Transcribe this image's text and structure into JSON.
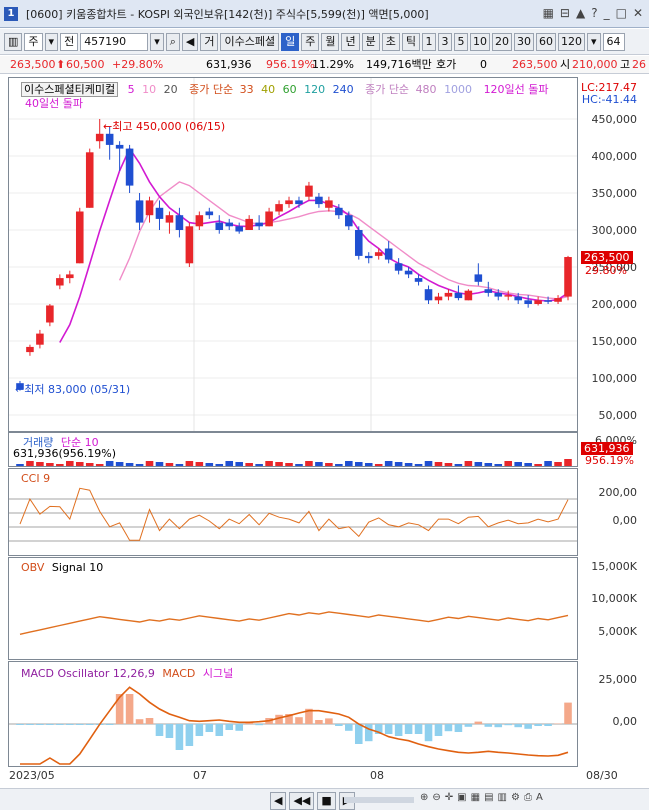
{
  "window": {
    "app_badge": "1",
    "title": "[0600] 키움종합차트 - KOSPI 외국인보유[142(천)] 주식수[5,599(천)] 액면[5,000]"
  },
  "toolbar": {
    "period_combo": "주",
    "market_btn": "전",
    "code": "457190",
    "name_prefix": "거",
    "stock_name": "이수스페셜",
    "period_buttons": [
      "일",
      "주",
      "월",
      "년",
      "분",
      "초",
      "틱"
    ],
    "active_period": "일",
    "interval_buttons": [
      "1",
      "3",
      "5",
      "10",
      "20",
      "30",
      "60",
      "120"
    ],
    "count": "64"
  },
  "info": {
    "price": "263,500",
    "change": "60,500",
    "change_pct": "+29.80%",
    "volume": "631,936",
    "volume_ratio": "956.19%",
    "turnover": "11.29%",
    "amount": "149,716백만",
    "quote_label": "호가",
    "quote_value": "0",
    "current": "263,500",
    "open_label": "시",
    "open": "210,000",
    "high_label": "고",
    "high": "26"
  },
  "price_pane": {
    "legend_name": "이수스페셜티케미컬",
    "ma_periods": [
      "5",
      "10",
      "20"
    ],
    "ma_label": "종가 단순",
    "ma_periods2": [
      "33",
      "40",
      "60",
      "120",
      "240"
    ],
    "ma_label2": "종가 단순",
    "ma_periods3": [
      "480",
      "1000"
    ],
    "breakout1": "120일선 돌파",
    "breakout2": "40일선 돌파",
    "lc": "LC:217.47",
    "hc": "HC:-41.44",
    "high_marker": "최고 450,000 (06/15)",
    "low_marker": "최저 83,000 (05/31)",
    "axis": [
      "450,000",
      "400,000",
      "350,000",
      "300,000",
      "250,000",
      "200,000",
      "150,000",
      "100,000",
      "50,000"
    ],
    "last_price_tag": "263,500",
    "last_pct_tag": "29.80%",
    "colors": {
      "up": "#e8262a",
      "down": "#1f4fd1",
      "ma5": "#d21ad2",
      "ma10": "#f08cc8",
      "ma20": "#333333",
      "ma60": "#d24d1a",
      "ma120": "#90b030"
    }
  },
  "volume_pane": {
    "title": "거래량",
    "ma_label": "단순 10",
    "value_text": "631,936(956.19%)",
    "axis_top": "6,000%",
    "tag1": "631,936",
    "tag2": "956.19%"
  },
  "cci_pane": {
    "title": "CCI 9",
    "axis": [
      "200,00",
      "0,00"
    ]
  },
  "obv_pane": {
    "title": "OBV",
    "signal": "Signal 10",
    "axis": [
      "15,000K",
      "10,000K",
      "5,000K"
    ]
  },
  "macd_pane": {
    "title": "MACD Oscillator 12,26,9",
    "macd": "MACD",
    "signal": "시그널",
    "axis": [
      "25,000",
      "0,00"
    ]
  },
  "dates": [
    "2023/05",
    "07",
    "08",
    "08/30"
  ],
  "chart_data": {
    "type": "candlestick",
    "candles": [
      {
        "o": 93000,
        "h": 96000,
        "l": 83000,
        "c": 85000
      },
      {
        "o": 135000,
        "h": 145000,
        "l": 130000,
        "c": 142000
      },
      {
        "o": 145000,
        "h": 165000,
        "l": 140000,
        "c": 160000
      },
      {
        "o": 175000,
        "h": 200000,
        "l": 170000,
        "c": 198000
      },
      {
        "o": 225000,
        "h": 240000,
        "l": 220000,
        "c": 235000
      },
      {
        "o": 235000,
        "h": 245000,
        "l": 228000,
        "c": 240000
      },
      {
        "o": 255000,
        "h": 330000,
        "l": 255000,
        "c": 325000
      },
      {
        "o": 330000,
        "h": 410000,
        "l": 330000,
        "c": 405000
      },
      {
        "o": 420000,
        "h": 450000,
        "l": 410000,
        "c": 430000
      },
      {
        "o": 430000,
        "h": 440000,
        "l": 395000,
        "c": 415000
      },
      {
        "o": 415000,
        "h": 420000,
        "l": 380000,
        "c": 410000
      },
      {
        "o": 410000,
        "h": 415000,
        "l": 350000,
        "c": 360000
      },
      {
        "o": 340000,
        "h": 350000,
        "l": 300000,
        "c": 310000
      },
      {
        "o": 320000,
        "h": 345000,
        "l": 310000,
        "c": 340000
      },
      {
        "o": 330000,
        "h": 340000,
        "l": 300000,
        "c": 315000
      },
      {
        "o": 310000,
        "h": 325000,
        "l": 295000,
        "c": 320000
      },
      {
        "o": 320000,
        "h": 330000,
        "l": 290000,
        "c": 300000
      },
      {
        "o": 255000,
        "h": 310000,
        "l": 250000,
        "c": 305000
      },
      {
        "o": 305000,
        "h": 325000,
        "l": 300000,
        "c": 320000
      },
      {
        "o": 325000,
        "h": 330000,
        "l": 315000,
        "c": 320000
      },
      {
        "o": 310000,
        "h": 320000,
        "l": 295000,
        "c": 300000
      },
      {
        "o": 310000,
        "h": 315000,
        "l": 300000,
        "c": 305000
      },
      {
        "o": 305000,
        "h": 310000,
        "l": 295000,
        "c": 298000
      },
      {
        "o": 300000,
        "h": 320000,
        "l": 300000,
        "c": 315000
      },
      {
        "o": 310000,
        "h": 320000,
        "l": 300000,
        "c": 305000
      },
      {
        "o": 305000,
        "h": 330000,
        "l": 305000,
        "c": 325000
      },
      {
        "o": 325000,
        "h": 340000,
        "l": 320000,
        "c": 335000
      },
      {
        "o": 335000,
        "h": 345000,
        "l": 330000,
        "c": 340000
      },
      {
        "o": 340000,
        "h": 345000,
        "l": 330000,
        "c": 335000
      },
      {
        "o": 345000,
        "h": 365000,
        "l": 340000,
        "c": 360000
      },
      {
        "o": 345000,
        "h": 350000,
        "l": 330000,
        "c": 335000
      },
      {
        "o": 330000,
        "h": 345000,
        "l": 325000,
        "c": 340000
      },
      {
        "o": 330000,
        "h": 335000,
        "l": 315000,
        "c": 320000
      },
      {
        "o": 320000,
        "h": 325000,
        "l": 300000,
        "c": 305000
      },
      {
        "o": 300000,
        "h": 305000,
        "l": 260000,
        "c": 265000
      },
      {
        "o": 265000,
        "h": 270000,
        "l": 255000,
        "c": 262000
      },
      {
        "o": 265000,
        "h": 275000,
        "l": 260000,
        "c": 270000
      },
      {
        "o": 275000,
        "h": 285000,
        "l": 255000,
        "c": 260000
      },
      {
        "o": 255000,
        "h": 262000,
        "l": 240000,
        "c": 245000
      },
      {
        "o": 245000,
        "h": 250000,
        "l": 235000,
        "c": 240000
      },
      {
        "o": 235000,
        "h": 240000,
        "l": 225000,
        "c": 230000
      },
      {
        "o": 220000,
        "h": 225000,
        "l": 200000,
        "c": 205000
      },
      {
        "o": 205000,
        "h": 215000,
        "l": 200000,
        "c": 210000
      },
      {
        "o": 210000,
        "h": 220000,
        "l": 205000,
        "c": 215000
      },
      {
        "o": 215000,
        "h": 225000,
        "l": 205000,
        "c": 208000
      },
      {
        "o": 205000,
        "h": 220000,
        "l": 205000,
        "c": 218000
      },
      {
        "o": 240000,
        "h": 255000,
        "l": 225000,
        "c": 230000
      },
      {
        "o": 220000,
        "h": 230000,
        "l": 210000,
        "c": 215000
      },
      {
        "o": 215000,
        "h": 220000,
        "l": 205000,
        "c": 210000
      },
      {
        "o": 210000,
        "h": 218000,
        "l": 205000,
        "c": 212000
      },
      {
        "o": 210000,
        "h": 215000,
        "l": 200000,
        "c": 205000
      },
      {
        "o": 205000,
        "h": 212000,
        "l": 195000,
        "c": 200000
      },
      {
        "o": 200000,
        "h": 210000,
        "l": 198000,
        "c": 205000
      },
      {
        "o": 205000,
        "h": 210000,
        "l": 200000,
        "c": 203000
      },
      {
        "o": 203000,
        "h": 212000,
        "l": 200000,
        "c": 208000
      },
      {
        "o": 210000,
        "h": 265000,
        "l": 205000,
        "c": 263500
      }
    ],
    "ma5": [
      null,
      null,
      null,
      null,
      148000,
      172000,
      210000,
      254000,
      299000,
      340000,
      380000,
      410000,
      390000,
      365000,
      345000,
      330000,
      320000,
      310000,
      308000,
      310000,
      312000,
      308000,
      305000,
      305000,
      307000,
      310000,
      318000,
      325000,
      333000,
      340000,
      340000,
      335000,
      330000,
      320000,
      300000,
      285000,
      275000,
      262000,
      255000,
      250000,
      240000,
      232000,
      225000,
      220000,
      215000,
      213000,
      215000,
      218000,
      215000,
      213000,
      210000,
      207000,
      205000,
      204000,
      206000,
      215000
    ],
    "ma10": [
      null,
      null,
      null,
      null,
      null,
      null,
      null,
      null,
      null,
      null,
      232000,
      262000,
      298000,
      325000,
      345000,
      355000,
      365000,
      360000,
      350000,
      340000,
      330000,
      320000,
      315000,
      310000,
      308000,
      310000,
      312000,
      315000,
      318000,
      322000,
      325000,
      326000,
      325000,
      322000,
      315000,
      305000,
      295000,
      285000,
      275000,
      265000,
      255000,
      248000,
      240000,
      233000,
      228000,
      225000,
      224000,
      222000,
      218000,
      215000,
      213000,
      212000,
      210000,
      208000,
      207000,
      210000
    ]
  }
}
